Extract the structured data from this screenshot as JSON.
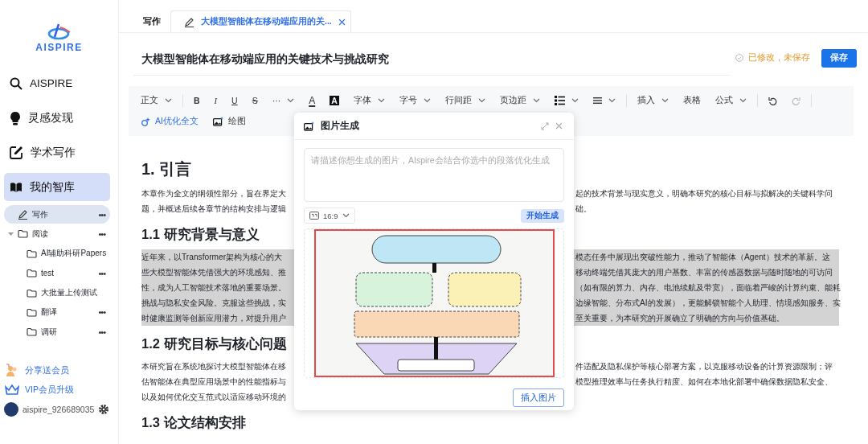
{
  "sidebar": {
    "logo": "AISPIRE",
    "nav": [
      {
        "label": "AISPIRE",
        "selected": false
      },
      {
        "label": "灵感发现",
        "selected": false
      },
      {
        "label": "学术写作",
        "selected": false
      },
      {
        "label": "我的智库",
        "selected": true
      }
    ],
    "tree": [
      {
        "label": "写作",
        "kind": "doc",
        "selected": true,
        "more": "•••"
      },
      {
        "label": "阅读",
        "kind": "folder",
        "selected": false,
        "more": "•••",
        "expanded": true,
        "children": [
          {
            "label": "AI辅助科研Papers",
            "kind": "folder",
            "selected": false
          },
          {
            "label": "test",
            "kind": "folder",
            "selected": false,
            "more": "•••"
          },
          {
            "label": "大批量上传测试",
            "kind": "folder",
            "selected": false
          },
          {
            "label": "翻译",
            "kind": "folder",
            "selected": false,
            "more": "•••"
          },
          {
            "label": "调研",
            "kind": "folder",
            "selected": false,
            "more": "•••"
          }
        ]
      }
    ],
    "promos": [
      {
        "label": "分享送会员"
      },
      {
        "label": "VIP会员升级"
      }
    ],
    "user": {
      "name": "aispire_926689035"
    }
  },
  "tabs": [
    {
      "label": "写作",
      "selected": false,
      "closable": false
    },
    {
      "label": "大模型智能体在移动端应用的关...",
      "selected": true,
      "closable": true
    }
  ],
  "document": {
    "title": "大模型智能体在移动端应用的关键技术与挑战研究",
    "save_status": "已修改，未保存",
    "save_button": "保存"
  },
  "toolbar": {
    "rows": [
      [
        {
          "kind": "dropdown",
          "label": "正文"
        },
        {
          "kind": "divider"
        },
        {
          "kind": "bold",
          "label": "B"
        },
        {
          "kind": "italic",
          "label": "I"
        },
        {
          "kind": "underline",
          "label": "U"
        },
        {
          "kind": "strike",
          "label": "S"
        },
        {
          "kind": "dropdown",
          "label": "···"
        },
        {
          "kind": "font-color",
          "label": "A"
        },
        {
          "kind": "highlight",
          "label": "A"
        },
        {
          "kind": "dropdown",
          "label": "字体"
        },
        {
          "kind": "dropdown",
          "label": "字号"
        },
        {
          "kind": "dropdown",
          "label": "行间距"
        },
        {
          "kind": "dropdown",
          "label": "页边距"
        },
        {
          "kind": "list"
        },
        {
          "kind": "align"
        },
        {
          "kind": "divider"
        },
        {
          "kind": "dropdown",
          "label": "插入"
        },
        {
          "kind": "plain",
          "label": "表格"
        },
        {
          "kind": "dropdown",
          "label": "公式"
        },
        {
          "kind": "divider"
        },
        {
          "kind": "undo",
          "disabled": false
        },
        {
          "kind": "redo",
          "disabled": true
        },
        {
          "kind": "divider"
        }
      ],
      [
        {
          "kind": "ai-action",
          "label": "AI优化全文"
        },
        {
          "kind": "draw-action",
          "label": "绘图"
        }
      ]
    ]
  },
  "body": [
    {
      "kind": "heading1",
      "text": "1. 引言"
    },
    {
      "kind": "paragraph",
      "highlighted": false,
      "lines": [
        {
          "left": "本章作为全文的纲领性部分，旨在界定大",
          "right": "起的技术背景与现实意义，明确本研究的核心目标与拟解决的关键科学问"
        },
        {
          "left": "题，并概述后续各章节的结构安排与逻辑",
          "right": "础。"
        }
      ]
    },
    {
      "kind": "heading2",
      "text": "1.1 研究背景与意义"
    },
    {
      "kind": "paragraph",
      "highlighted": true,
      "lines": [
        {
          "left": "近年来，以Transformer架构为核心的大",
          "right": "模态任务中展现出突破性能力，推动了智能体（Agent）技术的革新。这"
        },
        {
          "left": "些大模型智能体凭借强大的环境感知、推",
          "right": "移动终端凭借其庞大的用户基数、丰富的传感器数据与随时随地的可访问"
        },
        {
          "left": "性，成为人工智能技术落地的重要场景。",
          "right": "（如有限的算力、内存、电池续航及带宽），面临着严峻的计算约束、能耗"
        },
        {
          "left": "挑战与隐私安全风险。克服这些挑战，实",
          "right": "边缘智能、分布式AI的发展），更能解锁智能个人助理、情境感知服务、实"
        },
        {
          "left": "时健康监测等创新应用潜力，对提升用户",
          "right": "至关重要，为本研究的开展确立了明确的方向与价值基础。"
        }
      ]
    },
    {
      "kind": "heading2",
      "text": "1.2 研究目标与核心问题"
    },
    {
      "kind": "paragraph",
      "highlighted": false,
      "lines": [
        {
          "left": "本研究旨在系统地探讨大模型智能体在移",
          "right": "件适配及隐私保护等核心部署方案，以克服移动设备的计算资源限制；评"
        },
        {
          "left": "估智能体在典型应用场景中的性能指标与",
          "right": "模型推理效率与任务执行精度、如何在本地化部署中确保数据隐私安全、"
        },
        {
          "left": "以及如何优化交互范式以适应移动环境的"
        }
      ]
    },
    {
      "kind": "heading2",
      "text": "1.3 论文结构安排"
    }
  ],
  "dialog": {
    "title": "图片生成",
    "placeholder": "请描述你想生成的图片，AIspire会结合你选中的段落优化生成",
    "ratio": "16:9",
    "generate_button": "开始生成",
    "image": {
      "kind": "picture",
      "selected": true
    },
    "insert_button": "插入图片"
  }
}
